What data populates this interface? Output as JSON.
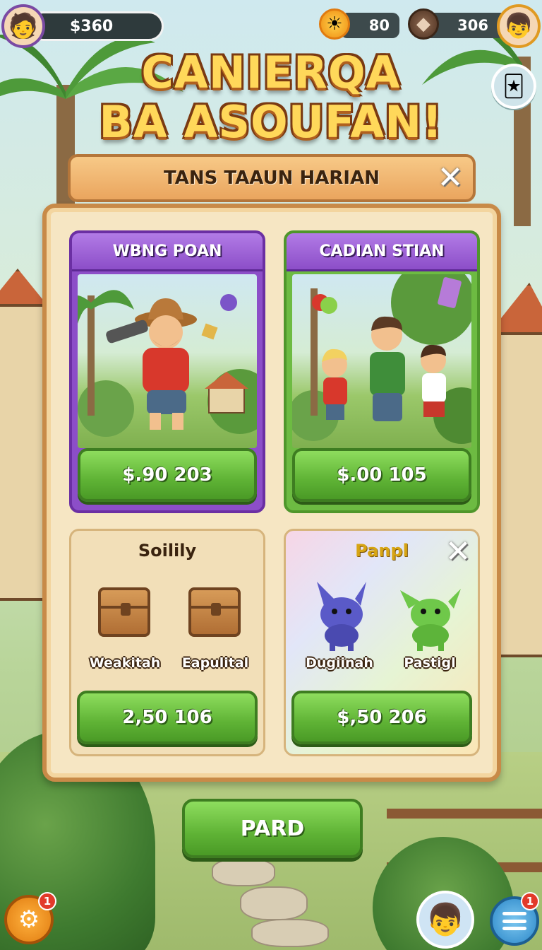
{
  "hud": {
    "money": "$360",
    "gems": "80",
    "stone": "306",
    "left_avatar_icon": "player-avatar",
    "right_avatar_icon": "friend-avatar"
  },
  "title": {
    "line1": "CANIERQA",
    "line2": "BA ASOUFAN!"
  },
  "dialog": {
    "header": "TANS TAAUN HARIAN",
    "close": "✕"
  },
  "offers": [
    {
      "title": "WBNG POAN",
      "price": "$.90 203",
      "color": "#8c4ec8"
    },
    {
      "title": "CADIAN STIAN",
      "price": "$.00 105",
      "color": "#6dbb42"
    }
  ],
  "bundles": [
    {
      "title": "Soilily",
      "items": [
        "Weakitah",
        "Eapulital"
      ],
      "price": "2,50 106"
    },
    {
      "title": "Panpl",
      "items": [
        "Dugiinah",
        "Pastigl"
      ],
      "price": "$,50 206"
    }
  ],
  "pard": "PARD",
  "badges": {
    "settings": "1",
    "menu": "1"
  }
}
